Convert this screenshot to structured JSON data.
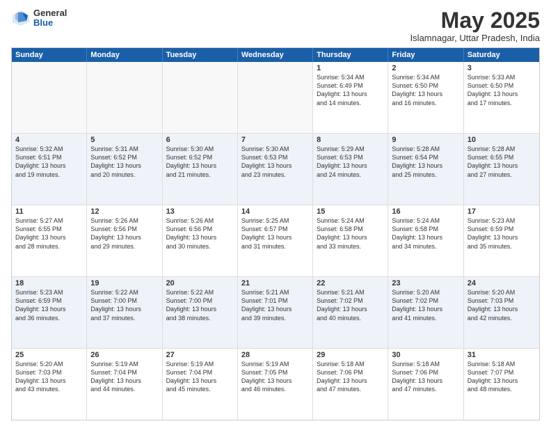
{
  "logo": {
    "general": "General",
    "blue": "Blue"
  },
  "title": "May 2025",
  "subtitle": "Islamnagar, Uttar Pradesh, India",
  "header_days": [
    "Sunday",
    "Monday",
    "Tuesday",
    "Wednesday",
    "Thursday",
    "Friday",
    "Saturday"
  ],
  "rows": [
    [
      {
        "day": "",
        "text": "",
        "empty": true
      },
      {
        "day": "",
        "text": "",
        "empty": true
      },
      {
        "day": "",
        "text": "",
        "empty": true
      },
      {
        "day": "",
        "text": "",
        "empty": true
      },
      {
        "day": "1",
        "text": "Sunrise: 5:34 AM\nSunset: 6:49 PM\nDaylight: 13 hours\nand 14 minutes."
      },
      {
        "day": "2",
        "text": "Sunrise: 5:34 AM\nSunset: 6:50 PM\nDaylight: 13 hours\nand 16 minutes."
      },
      {
        "day": "3",
        "text": "Sunrise: 5:33 AM\nSunset: 6:50 PM\nDaylight: 13 hours\nand 17 minutes."
      }
    ],
    [
      {
        "day": "4",
        "text": "Sunrise: 5:32 AM\nSunset: 6:51 PM\nDaylight: 13 hours\nand 19 minutes."
      },
      {
        "day": "5",
        "text": "Sunrise: 5:31 AM\nSunset: 6:52 PM\nDaylight: 13 hours\nand 20 minutes."
      },
      {
        "day": "6",
        "text": "Sunrise: 5:30 AM\nSunset: 6:52 PM\nDaylight: 13 hours\nand 21 minutes."
      },
      {
        "day": "7",
        "text": "Sunrise: 5:30 AM\nSunset: 6:53 PM\nDaylight: 13 hours\nand 23 minutes."
      },
      {
        "day": "8",
        "text": "Sunrise: 5:29 AM\nSunset: 6:53 PM\nDaylight: 13 hours\nand 24 minutes."
      },
      {
        "day": "9",
        "text": "Sunrise: 5:28 AM\nSunset: 6:54 PM\nDaylight: 13 hours\nand 25 minutes."
      },
      {
        "day": "10",
        "text": "Sunrise: 5:28 AM\nSunset: 6:55 PM\nDaylight: 13 hours\nand 27 minutes."
      }
    ],
    [
      {
        "day": "11",
        "text": "Sunrise: 5:27 AM\nSunset: 6:55 PM\nDaylight: 13 hours\nand 28 minutes."
      },
      {
        "day": "12",
        "text": "Sunrise: 5:26 AM\nSunset: 6:56 PM\nDaylight: 13 hours\nand 29 minutes."
      },
      {
        "day": "13",
        "text": "Sunrise: 5:26 AM\nSunset: 6:56 PM\nDaylight: 13 hours\nand 30 minutes."
      },
      {
        "day": "14",
        "text": "Sunrise: 5:25 AM\nSunset: 6:57 PM\nDaylight: 13 hours\nand 31 minutes."
      },
      {
        "day": "15",
        "text": "Sunrise: 5:24 AM\nSunset: 6:58 PM\nDaylight: 13 hours\nand 33 minutes."
      },
      {
        "day": "16",
        "text": "Sunrise: 5:24 AM\nSunset: 6:58 PM\nDaylight: 13 hours\nand 34 minutes."
      },
      {
        "day": "17",
        "text": "Sunrise: 5:23 AM\nSunset: 6:59 PM\nDaylight: 13 hours\nand 35 minutes."
      }
    ],
    [
      {
        "day": "18",
        "text": "Sunrise: 5:23 AM\nSunset: 6:59 PM\nDaylight: 13 hours\nand 36 minutes."
      },
      {
        "day": "19",
        "text": "Sunrise: 5:22 AM\nSunset: 7:00 PM\nDaylight: 13 hours\nand 37 minutes."
      },
      {
        "day": "20",
        "text": "Sunrise: 5:22 AM\nSunset: 7:00 PM\nDaylight: 13 hours\nand 38 minutes."
      },
      {
        "day": "21",
        "text": "Sunrise: 5:21 AM\nSunset: 7:01 PM\nDaylight: 13 hours\nand 39 minutes."
      },
      {
        "day": "22",
        "text": "Sunrise: 5:21 AM\nSunset: 7:02 PM\nDaylight: 13 hours\nand 40 minutes."
      },
      {
        "day": "23",
        "text": "Sunrise: 5:20 AM\nSunset: 7:02 PM\nDaylight: 13 hours\nand 41 minutes."
      },
      {
        "day": "24",
        "text": "Sunrise: 5:20 AM\nSunset: 7:03 PM\nDaylight: 13 hours\nand 42 minutes."
      }
    ],
    [
      {
        "day": "25",
        "text": "Sunrise: 5:20 AM\nSunset: 7:03 PM\nDaylight: 13 hours\nand 43 minutes."
      },
      {
        "day": "26",
        "text": "Sunrise: 5:19 AM\nSunset: 7:04 PM\nDaylight: 13 hours\nand 44 minutes."
      },
      {
        "day": "27",
        "text": "Sunrise: 5:19 AM\nSunset: 7:04 PM\nDaylight: 13 hours\nand 45 minutes."
      },
      {
        "day": "28",
        "text": "Sunrise: 5:19 AM\nSunset: 7:05 PM\nDaylight: 13 hours\nand 46 minutes."
      },
      {
        "day": "29",
        "text": "Sunrise: 5:18 AM\nSunset: 7:06 PM\nDaylight: 13 hours\nand 47 minutes."
      },
      {
        "day": "30",
        "text": "Sunrise: 5:18 AM\nSunset: 7:06 PM\nDaylight: 13 hours\nand 47 minutes."
      },
      {
        "day": "31",
        "text": "Sunrise: 5:18 AM\nSunset: 7:07 PM\nDaylight: 13 hours\nand 48 minutes."
      }
    ]
  ]
}
